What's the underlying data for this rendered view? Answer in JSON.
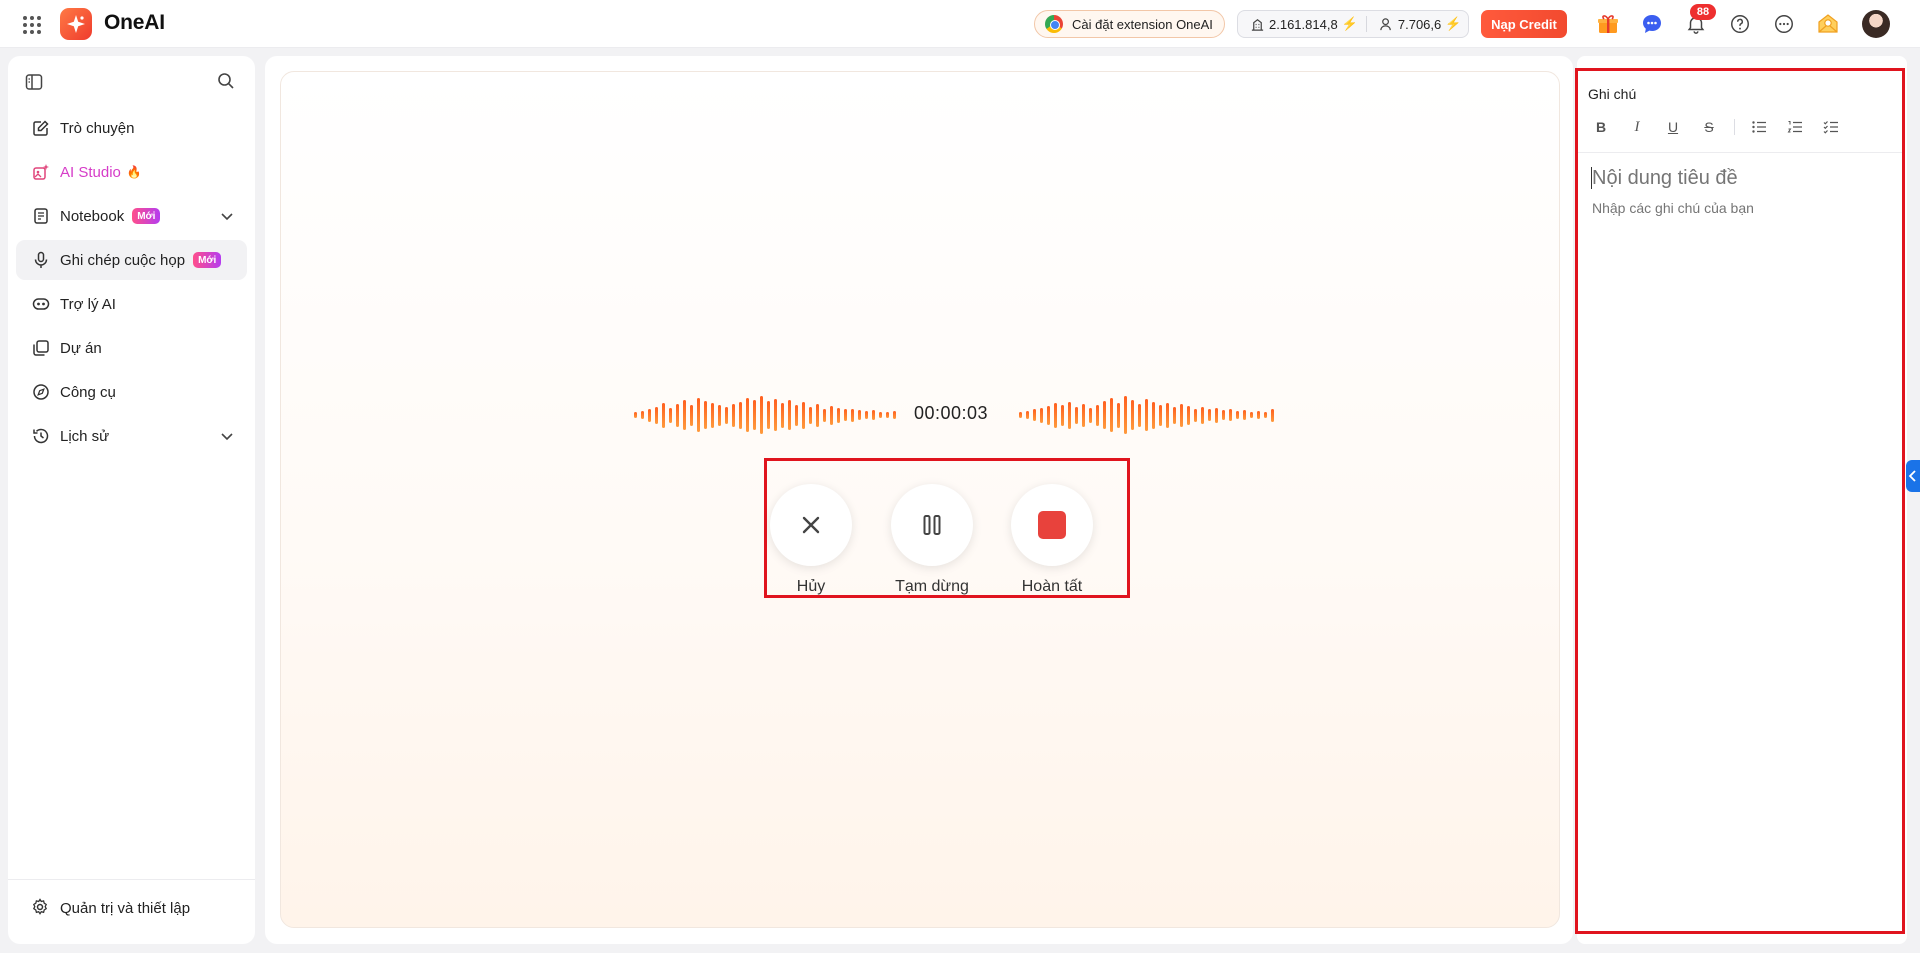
{
  "app": {
    "name": "OneAI"
  },
  "topbar": {
    "extension_label": "Cài đặt extension OneAI",
    "credit_org": "2.161.814,8",
    "credit_user": "7.706,6",
    "topup_label": "Nạp Credit",
    "notification_count": "88",
    "accent_color": "#f24a2f"
  },
  "sidebar": {
    "items": [
      {
        "label": "Trò chuyện",
        "icon": "edit-icon"
      },
      {
        "label": "AI Studio",
        "icon": "studio-icon"
      },
      {
        "label": "Notebook",
        "icon": "notebook-icon",
        "badge": "Mới"
      },
      {
        "label": "Ghi chép cuộc họp",
        "icon": "mic-icon",
        "badge": "Mới",
        "active": true
      },
      {
        "label": "Trợ lý AI",
        "icon": "assistant-icon"
      },
      {
        "label": "Dự án",
        "icon": "project-icon"
      },
      {
        "label": "Công cụ",
        "icon": "compass-icon"
      },
      {
        "label": "Lịch sử",
        "icon": "history-icon"
      }
    ],
    "settings_label": "Quản trị và thiết lập"
  },
  "recorder": {
    "timer": "00:00:03",
    "cancel_label": "Hủy",
    "pause_label": "Tạm dừng",
    "finish_label": "Hoàn tất",
    "wave_levels_left": [
      0.14,
      0.19,
      0.33,
      0.43,
      0.62,
      0.38,
      0.57,
      0.76,
      0.52,
      0.86,
      0.71,
      0.62,
      0.52,
      0.43,
      0.57,
      0.67,
      0.86,
      0.76,
      0.95,
      0.71,
      0.81,
      0.62,
      0.76,
      0.52,
      0.67,
      0.43,
      0.57,
      0.33,
      0.48,
      0.38,
      0.29,
      0.33,
      0.24,
      0.19,
      0.24,
      0.14,
      0.14,
      0.19
    ],
    "wave_levels_right": [
      0.14,
      0.19,
      0.29,
      0.38,
      0.48,
      0.62,
      0.52,
      0.67,
      0.43,
      0.57,
      0.38,
      0.52,
      0.71,
      0.86,
      0.62,
      0.95,
      0.76,
      0.57,
      0.81,
      0.67,
      0.52,
      0.62,
      0.43,
      0.57,
      0.48,
      0.33,
      0.43,
      0.29,
      0.38,
      0.24,
      0.29,
      0.19,
      0.24,
      0.14,
      0.19,
      0.14,
      0.33
    ]
  },
  "notes": {
    "title": "Ghi chú",
    "heading_placeholder": "Nội dung tiêu đề",
    "body_placeholder": "Nhập các ghi chú của bạn",
    "toolbar": [
      "bold-icon",
      "italic-icon",
      "underline-icon",
      "strikethrough-icon",
      "bullet-list-icon",
      "numbered-list-icon",
      "checklist-icon"
    ]
  }
}
